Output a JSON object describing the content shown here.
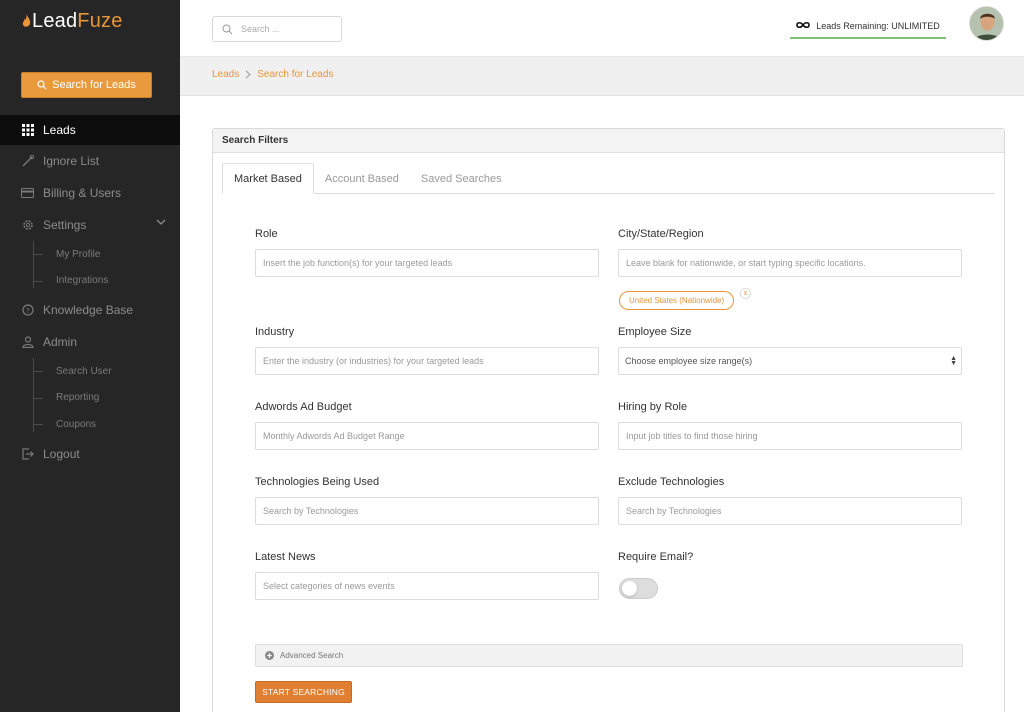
{
  "brand": {
    "name_part1": "Lead",
    "name_part2": "Fuze",
    "accent_color": "#e8953a"
  },
  "sidebar": {
    "search_button_label": "Search for Leads",
    "items": [
      {
        "label": "Leads",
        "icon": "grid-icon",
        "active": true
      },
      {
        "label": "Ignore List",
        "icon": "tool-icon"
      },
      {
        "label": "Billing & Users",
        "icon": "card-icon"
      },
      {
        "label": "Settings",
        "icon": "gear-icon"
      },
      {
        "label": "Knowledge Base",
        "icon": "question-icon"
      },
      {
        "label": "Admin",
        "icon": "user-icon"
      },
      {
        "label": "Logout",
        "icon": "logout-icon"
      }
    ],
    "settings_sub": [
      {
        "label": "My Profile"
      },
      {
        "label": "Integrations"
      }
    ],
    "admin_sub": [
      {
        "label": "Search User"
      },
      {
        "label": "Reporting"
      },
      {
        "label": "Coupons"
      }
    ]
  },
  "topbar": {
    "search_placeholder": "Search ...",
    "leads_remaining": "Leads Remaining: UNLIMITED"
  },
  "breadcrumb": {
    "root": "Leads",
    "current": "Search for Leads"
  },
  "panel": {
    "title": "Search Filters",
    "tabs": [
      {
        "label": "Market Based",
        "active": true
      },
      {
        "label": "Account Based"
      },
      {
        "label": "Saved Searches"
      }
    ]
  },
  "fields": {
    "role": {
      "label": "Role",
      "placeholder": "Insert the job function(s) for your targeted leads"
    },
    "city": {
      "label": "City/State/Region",
      "placeholder": "Leave blank for nationwide, or start typing specific locations.",
      "chip": "United States (Nationwide)",
      "chip_remove": "x"
    },
    "industry": {
      "label": "Industry",
      "placeholder": "Enter the industry (or industries) for your targeted leads"
    },
    "employee_size": {
      "label": "Employee Size",
      "value": "Choose employee size range(s)"
    },
    "adwords": {
      "label": "Adwords Ad Budget",
      "placeholder": "Monthly Adwords Ad Budget Range"
    },
    "hiring": {
      "label": "Hiring by Role",
      "placeholder": "Input job titles to find those hiring"
    },
    "technologies": {
      "label": "Technologies Being Used",
      "placeholder": "Search by Technologies"
    },
    "exclude_tech": {
      "label": "Exclude Technologies",
      "placeholder": "Search by Technologies"
    },
    "news": {
      "label": "Latest News",
      "placeholder": "Select categories of news events"
    },
    "require_email": {
      "label": "Require Email?",
      "enabled": false
    }
  },
  "advanced_label": "Advanced Search",
  "start_button": "START SEARCHING"
}
